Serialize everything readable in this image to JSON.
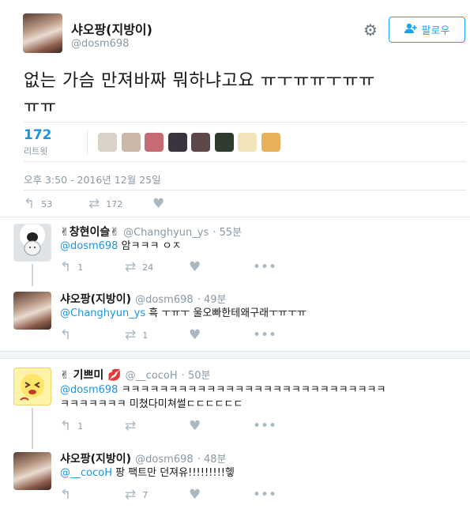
{
  "profile": {
    "display_name": "샤오팡(지방이)",
    "handle": "@dosm698",
    "follow_label": "팔로우"
  },
  "tweet": {
    "text_line1": "없는 가슴 만져바짜 뭐하냐고요 ㅠㅜㅠㅠㅜㅠㅠ",
    "text_line2": "ㅠㅠ",
    "retweet_count": "172",
    "retweet_label": "리트윗",
    "timestamp": "오후 3:50 - 2016년 12월 25일",
    "reply_count": "53",
    "retweets": "172"
  },
  "retweeter_avatars": [
    "#d8d2c9",
    "#c9b7a8",
    "#c46b76",
    "#3a3440",
    "#5b4a49",
    "#2f3b2f",
    "#f2e3b8",
    "#e6b25a"
  ],
  "replies": [
    {
      "name": "✌창현이슬✌",
      "handle": "@Changhyun_ys",
      "time": "· 55분",
      "mention": "@dosm698",
      "text": " 암ㅋㅋㅋ ㅇㅈ",
      "reply_count": "1",
      "retweet_count": "24"
    },
    {
      "name": "샤오팡(지방이)",
      "handle": "@dosm698",
      "time": "· 49분",
      "mention": "@Changhyun_ys",
      "text": " 흑 ㅜㅠㅜ 울오빠한테왜구래ㅜㅠㅜㅠ",
      "reply_count": "",
      "retweet_count": "1"
    },
    {
      "name": "✌ 기쁘미 💋",
      "handle": "@__cocoH",
      "time": "· 50분",
      "mention": "@dosm698",
      "text": " ㅋㅋㅋㅋㅋㅋㅋㅋㅋㅋㅋㅋㅋㅋㅋㅋㅋㅋㅋㅋㅋㅋㅋㅋㅋㅋㅋㅋ",
      "text2": "ㅋㅋㅋㅋㅋㅋㅋ 미쳤다미쳐썰ㄷㄷㄷㄷㄷㄷ",
      "reply_count": "1",
      "retweet_count": ""
    },
    {
      "name": "샤오팡(지방이)",
      "handle": "@dosm698",
      "time": "· 48분",
      "mention": "@__cocoH",
      "text": " 팡 팩트만 던져유!!!!!!!!!헿",
      "reply_count": "",
      "retweet_count": "7"
    }
  ]
}
